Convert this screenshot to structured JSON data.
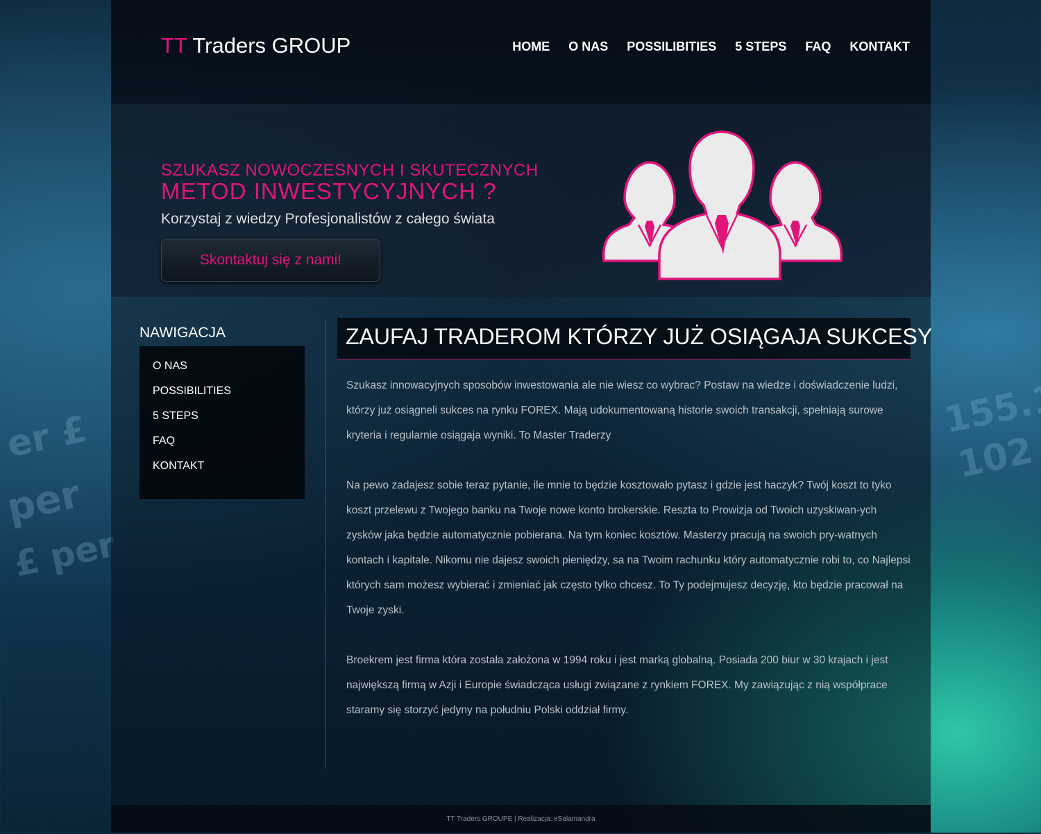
{
  "header": {
    "logo_accent": "TT",
    "logo_rest": " Traders GROUP",
    "nav": [
      "HOME",
      "O NAS",
      "POSSILIBITIES",
      "5 STEPS",
      "FAQ",
      "KONTAKT"
    ]
  },
  "hero": {
    "line1": "SZUKASZ NOWOCZESNYCH I SKUTECZNYCH",
    "line2": "METOD INWESTYCYJNYCH ?",
    "line3": "Korzystaj z wiedzy Profesjonalistów z całego świata",
    "cta_label": "Skontaktuj się z nami!",
    "icon": "people-group-icon"
  },
  "sidebar": {
    "title": "NAWIGACJA",
    "items": [
      "O NAS",
      "POSSIBILITIES",
      "5 STEPS",
      "FAQ",
      "KONTAKT"
    ]
  },
  "content": {
    "title": "ZAUFAJ TRADEROM KTÓRZY JUŻ OSIĄGAJA SUKCESY",
    "p1": "Szukasz innowacyjnych sposobów inwestowania ale nie wiesz co wybrac? Postaw na wiedze i doświadczenie ludzi, którzy już osiągneli sukces na rynku FOREX. Mają udokumentowaną historie swoich transakcji, spełniają surowe kryteria i regularnie osiągaja wyniki. To Master Traderzy",
    "p2": "Na pewo zadajesz sobie teraz pytanie, ile mnie to będzie kosztowało pytasz i gdzie jest haczyk? Twój koszt to tyko koszt przelewu z Twojego banku na Twoje nowe konto brokerskie. Reszta to Prowizja od Twoich uzyskiwan-ych zysków jaka będzie automatycznie pobierana. Na tym koniec kosztów. Masterzy pracują na swoich pry-watnych kontach i kapitale. Nikomu nie dajesz swoich pieniędzy, sa na Twoim rachunku który automatycznie robi to, co Najlepsi których sam możesz wybierać i zmieniać jak często tylko chcesz. To Ty podejmujesz decyzję, kto będzie pracował na Twoje zyski.",
    "p3": "Broekrem jest firma która została założona w 1994 roku i jest marką globalną. Posiada 200 biur w 30 krajach i jest największą firmą w Azji i Europie świadcząca usługi związane z rynkiem FOREX. My zawiązując z nią współprace staramy się storzyć jedyny na południu Polski oddział firmy."
  },
  "footer": {
    "text": "TT Traders GROUPE | Realizacja: eSalamandra"
  },
  "colors": {
    "accent": "#e0157a",
    "text": "#b9c0c6",
    "white": "#ffffff"
  }
}
